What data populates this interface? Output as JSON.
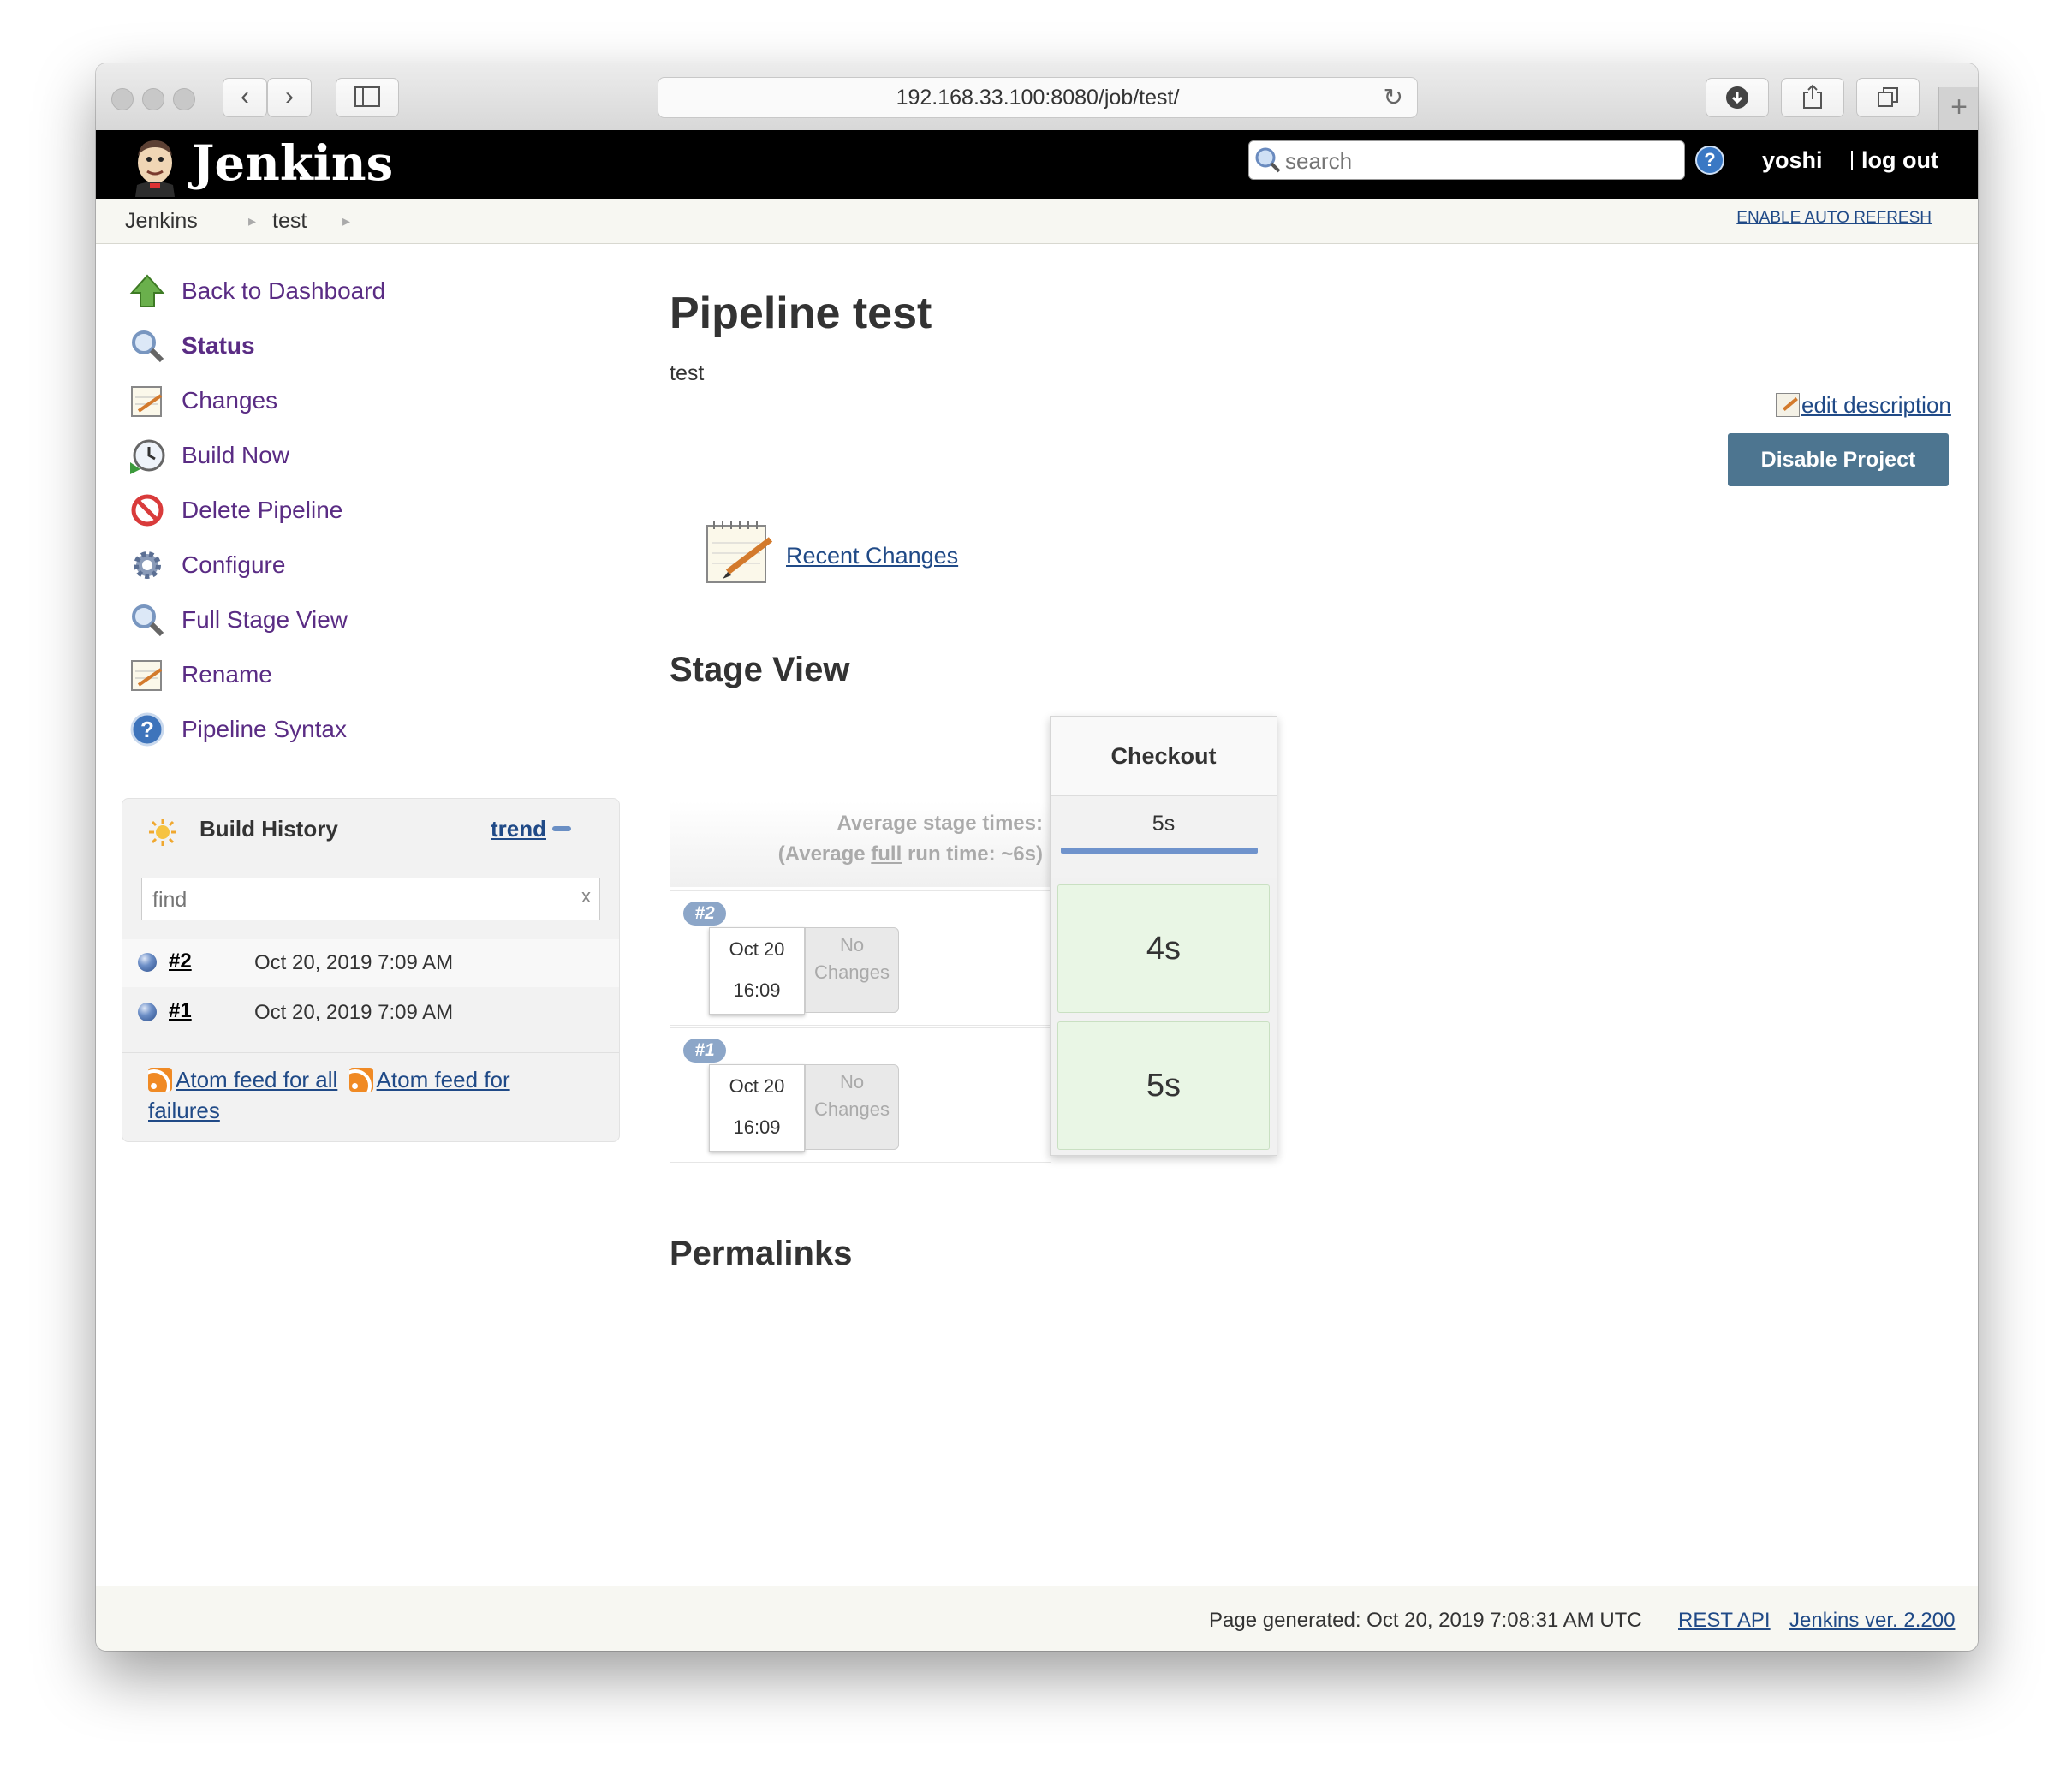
{
  "browser": {
    "url": "192.168.33.100:8080/job/test/"
  },
  "header": {
    "brand": "Jenkins",
    "search_placeholder": "search",
    "help_label": "?",
    "user": "yoshi",
    "logout": "log out"
  },
  "breadcrumb": {
    "items": [
      "Jenkins",
      "test"
    ],
    "auto_refresh": "ENABLE AUTO REFRESH"
  },
  "sidebar": {
    "tasks": [
      {
        "label": "Back to Dashboard",
        "icon": "up-arrow-icon"
      },
      {
        "label": "Status",
        "icon": "magnifier-icon"
      },
      {
        "label": "Changes",
        "icon": "notepad-icon"
      },
      {
        "label": "Build Now",
        "icon": "clock-icon"
      },
      {
        "label": "Delete Pipeline",
        "icon": "no-entry-icon"
      },
      {
        "label": "Configure",
        "icon": "gear-icon"
      },
      {
        "label": "Full Stage View",
        "icon": "magnifier-icon"
      },
      {
        "label": "Rename",
        "icon": "notepad-icon"
      },
      {
        "label": "Pipeline Syntax",
        "icon": "help-icon"
      }
    ]
  },
  "build_history": {
    "title": "Build History",
    "trend": "trend",
    "find_placeholder": "find",
    "clear": "x",
    "builds": [
      {
        "number": "#2",
        "date": "Oct 20, 2019 7:09 AM"
      },
      {
        "number": "#1",
        "date": "Oct 20, 2019 7:09 AM"
      }
    ],
    "feed_all": "Atom feed for all",
    "feed_failures_1": "Atom feed for",
    "feed_failures_2": "failures"
  },
  "main": {
    "title": "Pipeline test",
    "description": "test",
    "edit_description": "edit description",
    "disable_button": "Disable Project",
    "recent_changes": "Recent Changes",
    "stage_view_heading": "Stage View",
    "permalinks_heading": "Permalinks"
  },
  "stage_view": {
    "avg_stage_label": "Average stage times:",
    "avg_run_prefix": "(Average ",
    "avg_run_full": "full",
    "avg_run_suffix": " run time: ~6s)",
    "stage_name": "Checkout",
    "stage_avg": "5s",
    "runs": [
      {
        "badge": "#2",
        "date": "Oct 20",
        "time": "16:09",
        "changes": "No Changes",
        "duration": "4s"
      },
      {
        "badge": "#1",
        "date": "Oct 20",
        "time": "16:09",
        "changes": "No Changes",
        "duration": "5s"
      }
    ]
  },
  "footer": {
    "generated": "Page generated: Oct 20, 2019 7:08:31 AM UTC",
    "rest_api": "REST API",
    "version": "Jenkins ver. 2.200"
  }
}
